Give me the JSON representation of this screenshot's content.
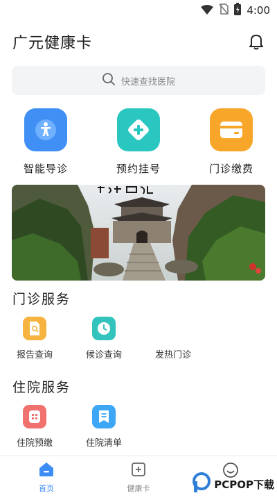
{
  "status_bar": {
    "time": "4:00"
  },
  "header": {
    "title": "广元健康卡",
    "notification_icon": "bell-icon"
  },
  "search": {
    "placeholder": "快速查找医院",
    "icon": "search-icon"
  },
  "quick_actions": [
    {
      "label": "智能导诊",
      "icon": "person-guide-icon",
      "color": "#3f8ff5"
    },
    {
      "label": "预约挂号",
      "icon": "plus-icon",
      "color": "#2ac6c0"
    },
    {
      "label": "门诊缴费",
      "icon": "wallet-icon",
      "color": "#f7a62a"
    }
  ],
  "outpatient": {
    "title": "门诊服务",
    "items": [
      {
        "label": "报告查询",
        "icon": "report-icon",
        "color": "#f6b33f"
      },
      {
        "label": "候诊查询",
        "icon": "clock-icon",
        "color": "#32c4bc"
      },
      {
        "label": "发热门诊",
        "icon": "",
        "color": ""
      }
    ]
  },
  "inpatient": {
    "title": "住院服务",
    "items": [
      {
        "label": "住院预缴",
        "icon": "deposit-icon",
        "color": "#f0716e"
      },
      {
        "label": "住院清单",
        "icon": "list-icon",
        "color": "#3da6f5"
      }
    ]
  },
  "tabbar": {
    "tabs": [
      {
        "label": "首页",
        "icon": "home-icon",
        "active": true
      },
      {
        "label": "健康卡",
        "icon": "card-plus-icon",
        "active": false
      },
      {
        "label": "",
        "icon": "smiley-icon",
        "active": false
      }
    ]
  },
  "watermark": {
    "text": "PCPOP下载"
  },
  "colors": {
    "accent": "#3d8df7"
  }
}
